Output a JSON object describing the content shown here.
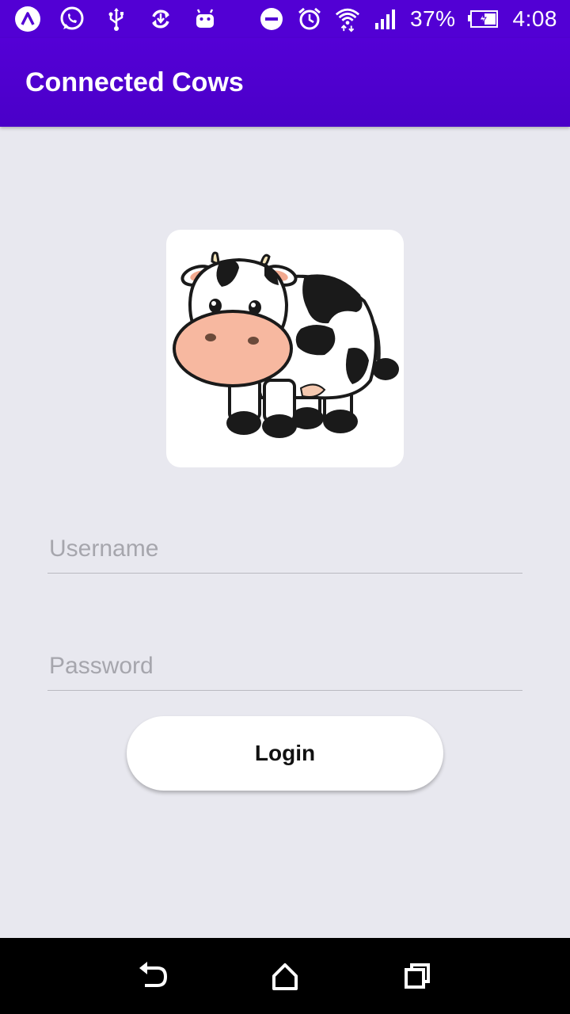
{
  "status_bar": {
    "battery_percent": "37%",
    "time": "4:08",
    "icons": [
      "app-a-icon",
      "whatsapp-icon",
      "usb-icon",
      "sync-icon",
      "android-icon",
      "do-not-disturb-icon",
      "alarm-icon",
      "wifi-icon",
      "signal-icon",
      "battery-charging-icon"
    ]
  },
  "app_bar": {
    "title": "Connected Cows"
  },
  "logo": {
    "icon": "cow-logo"
  },
  "form": {
    "username_placeholder": "Username",
    "password_placeholder": "Password",
    "login_label": "Login"
  },
  "nav_bar": {
    "icons": [
      "back-icon",
      "home-icon",
      "recents-icon"
    ]
  },
  "colors": {
    "primary": "#5200d4",
    "background": "#e8e8ef",
    "button_bg": "#ffffff"
  }
}
